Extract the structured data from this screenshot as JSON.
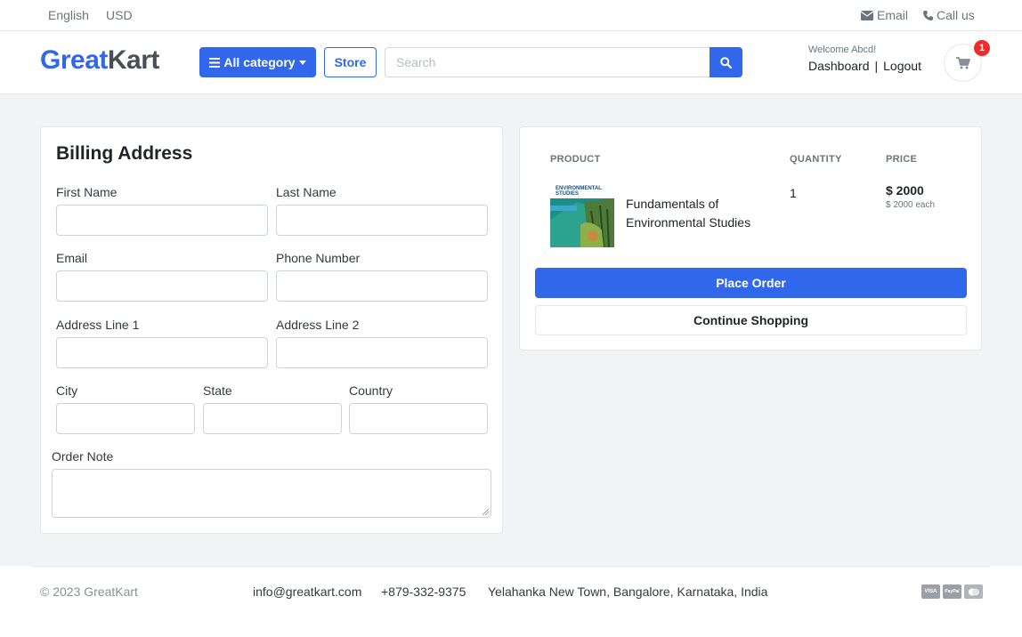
{
  "topbar": {
    "language": "English",
    "currency": "USD",
    "email_label": "Email",
    "call_label": "Call us"
  },
  "header": {
    "logo_part1": "Great",
    "logo_part2": "Kart",
    "category_label": "All category",
    "store_label": "Store",
    "search_placeholder": "Search",
    "welcome": "Welcome Abcd!",
    "dashboard_label": "Dashboard",
    "logout_label": "Logout",
    "cart_count": "1"
  },
  "billing": {
    "title": "Billing Address",
    "fields": {
      "first_name": "First Name",
      "last_name": "Last Name",
      "email": "Email",
      "phone": "Phone Number",
      "address1": "Address Line 1",
      "address2": "Address Line 2",
      "city": "City",
      "state": "State",
      "country": "Country",
      "order_note": "Order Note"
    }
  },
  "order": {
    "headers": {
      "product": "PRODUCT",
      "quantity": "QUANTITY",
      "price": "PRICE"
    },
    "item": {
      "cover_text": "ENVIRONMENTAL STUDIES",
      "name": "Fundamentals of Environmental Studies",
      "quantity": "1",
      "price": "$ 2000",
      "each": "$ 2000 each"
    },
    "place_order_label": "Place Order",
    "continue_label": "Continue Shopping"
  },
  "footer": {
    "copyright": "© 2023 GreatKart",
    "email": "info@greatkart.com",
    "phone": "+879-332-9375",
    "address": "Yelahanka New Town, Bangalore, Karnataka, India",
    "payments": [
      "VISA",
      "PayPal",
      "MC"
    ]
  },
  "colors": {
    "primary": "#3167eb",
    "badge": "#ee2b2b",
    "background": "#f2f3f5"
  }
}
